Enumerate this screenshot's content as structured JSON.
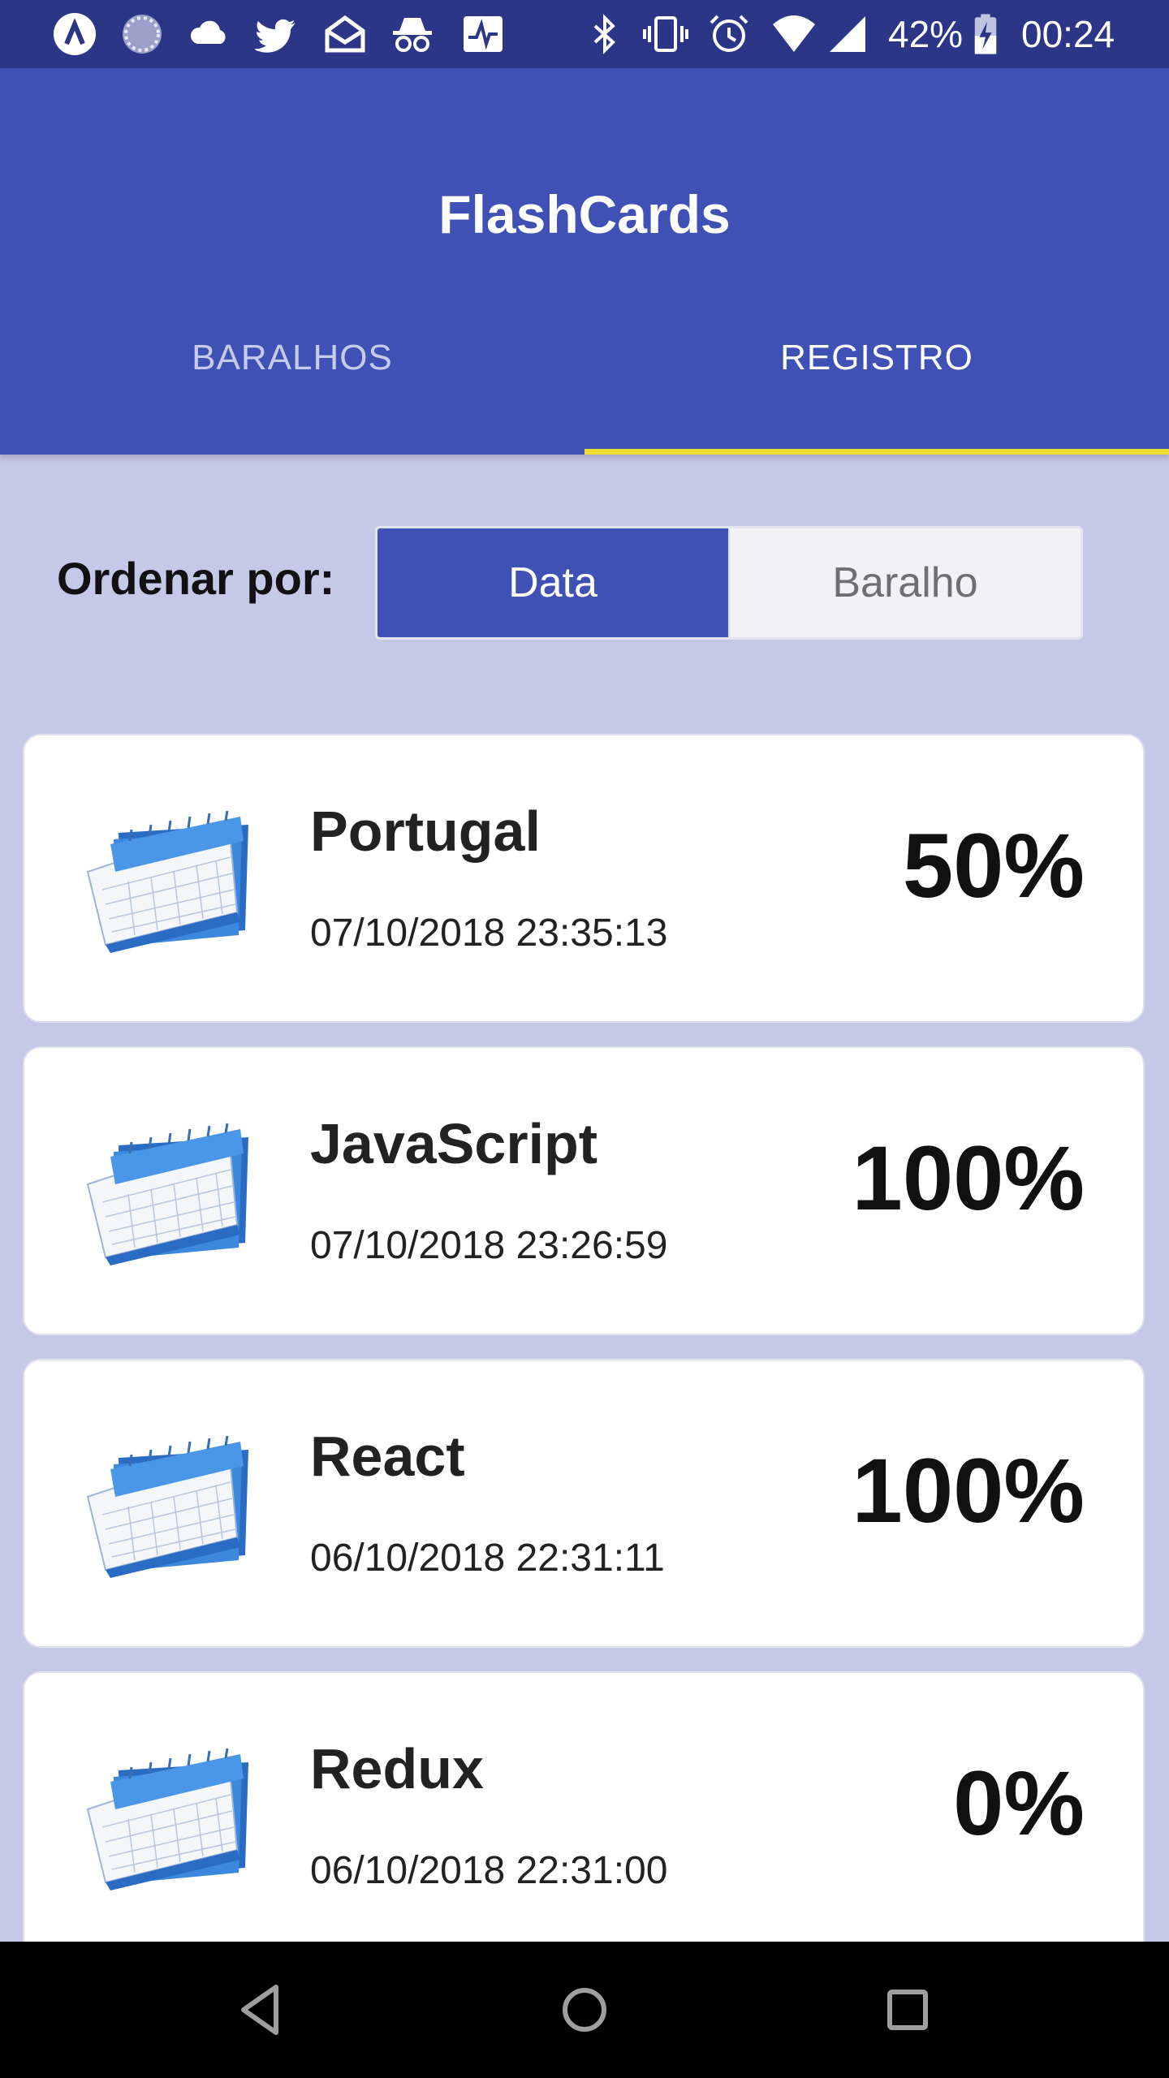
{
  "status_bar": {
    "battery": "42%",
    "time": "00:24",
    "left_icons": [
      "app-a-icon",
      "progress-ring-icon",
      "cloud-icon",
      "twitter-icon",
      "mail-icon",
      "incognito-icon",
      "activity-icon"
    ],
    "right_icons": [
      "bluetooth-icon",
      "vibrate-icon",
      "alarm-icon",
      "wifi-icon",
      "signal-icon",
      "battery-charging-icon"
    ]
  },
  "app": {
    "title": "FlashCards",
    "accent_color": "#3f51b5",
    "indicator_color": "#f0e033"
  },
  "tabs": [
    {
      "label": "BARALHOS",
      "active": false
    },
    {
      "label": "REGISTRO",
      "active": true
    }
  ],
  "sort": {
    "label": "Ordenar por:",
    "options": [
      "Data",
      "Baralho"
    ],
    "selected": "Data"
  },
  "records": [
    {
      "deck": "Portugal",
      "date": "07/10/2018 23:35:13",
      "score": "50%",
      "icon": "calendar-icon"
    },
    {
      "deck": "JavaScript",
      "date": "07/10/2018 23:26:59",
      "score": "100%",
      "icon": "calendar-icon"
    },
    {
      "deck": "React",
      "date": "06/10/2018 22:31:11",
      "score": "100%",
      "icon": "calendar-icon"
    },
    {
      "deck": "Redux",
      "date": "06/10/2018 22:31:00",
      "score": "0%",
      "icon": "calendar-icon"
    }
  ],
  "nav_bar": [
    "back-icon",
    "home-icon",
    "recents-icon"
  ]
}
